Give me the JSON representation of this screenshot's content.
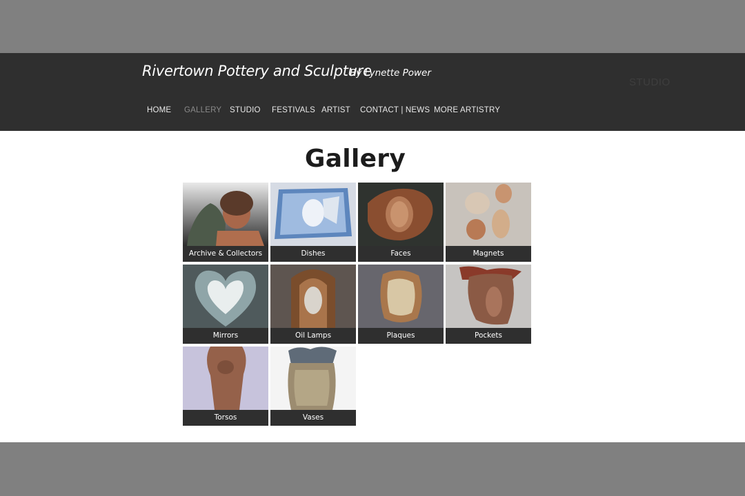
{
  "header": {
    "title": "Rivertown Pottery and Sculpture",
    "subtitle": "By Lynette Power",
    "ghost_label": "STUDIO"
  },
  "nav": {
    "items": [
      {
        "label": "HOME",
        "active": false
      },
      {
        "label": "GALLERY",
        "active": true
      },
      {
        "label": "STUDIO",
        "active": false
      },
      {
        "label": "FESTIVALS",
        "active": false
      },
      {
        "label": "ARTIST",
        "active": false
      },
      {
        "label": "CONTACT | NEWS",
        "active": false
      },
      {
        "label": "MORE ARTISTRY",
        "active": false
      }
    ]
  },
  "main": {
    "title": "Gallery",
    "tiles": [
      {
        "label": "Archive & Collectors"
      },
      {
        "label": "Dishes"
      },
      {
        "label": "Faces"
      },
      {
        "label": "Magnets"
      },
      {
        "label": "Mirrors"
      },
      {
        "label": "Oil Lamps"
      },
      {
        "label": "Plaques"
      },
      {
        "label": "Pockets"
      },
      {
        "label": "Torsos"
      },
      {
        "label": "Vases"
      }
    ]
  },
  "colors": {
    "page_bg": "#808080",
    "header_bg": "#2f2f2f",
    "nav_active": "#8a8a8a",
    "caption_bg": "#2f2f2f"
  }
}
